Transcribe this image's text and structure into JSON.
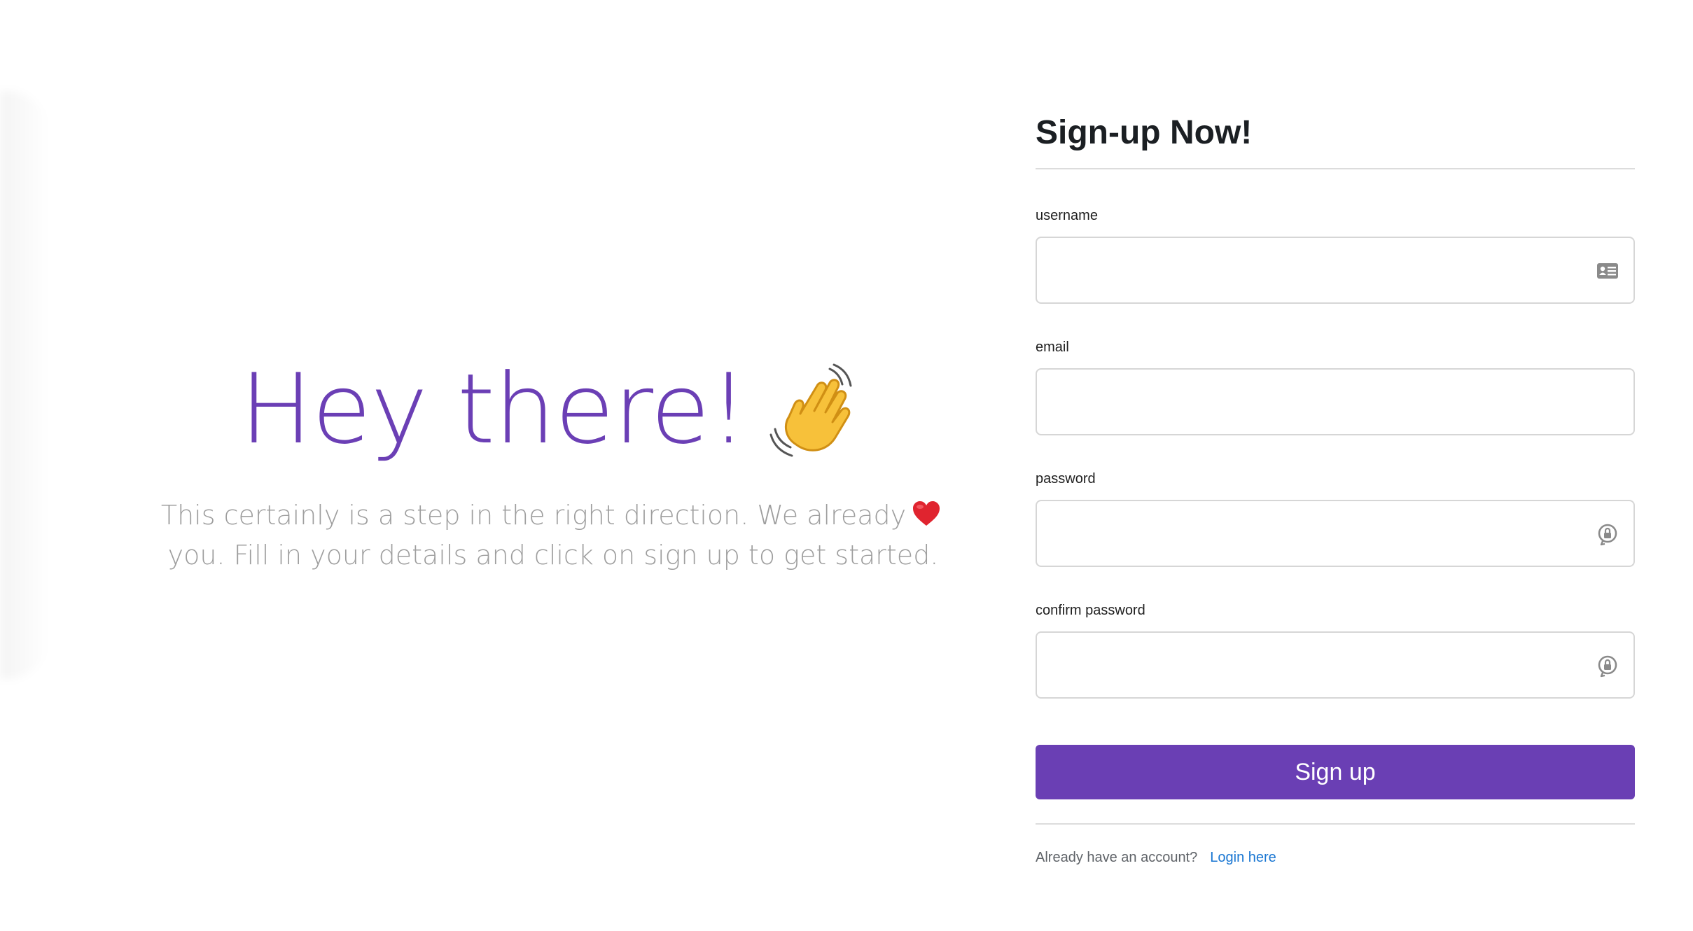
{
  "hero": {
    "title": "Hey there!",
    "wave_icon": "waving-hand-emoji",
    "subtitle_before_heart": "This certainly is a step in the right direction. We already",
    "heart_icon": "red-heart-emoji",
    "subtitle_after_heart": "you. Fill in your details and click on sign up to get started."
  },
  "form": {
    "title": "Sign-up Now!",
    "fields": [
      {
        "label": "username",
        "value": "",
        "placeholder": "",
        "icon": "id-card-icon"
      },
      {
        "label": "email",
        "value": "",
        "placeholder": "",
        "icon": ""
      },
      {
        "label": "password",
        "value": "",
        "placeholder": "",
        "icon": "password-lock-icon"
      },
      {
        "label": "confirm password",
        "value": "",
        "placeholder": "",
        "icon": "password-lock-icon"
      }
    ],
    "submit_label": "Sign up",
    "footer_text": "Already have an account?",
    "login_link": "Login here"
  },
  "colors": {
    "brand_purple": "#6a3fb4",
    "link_blue": "#1976d2",
    "muted_text": "#9e9e9e"
  }
}
